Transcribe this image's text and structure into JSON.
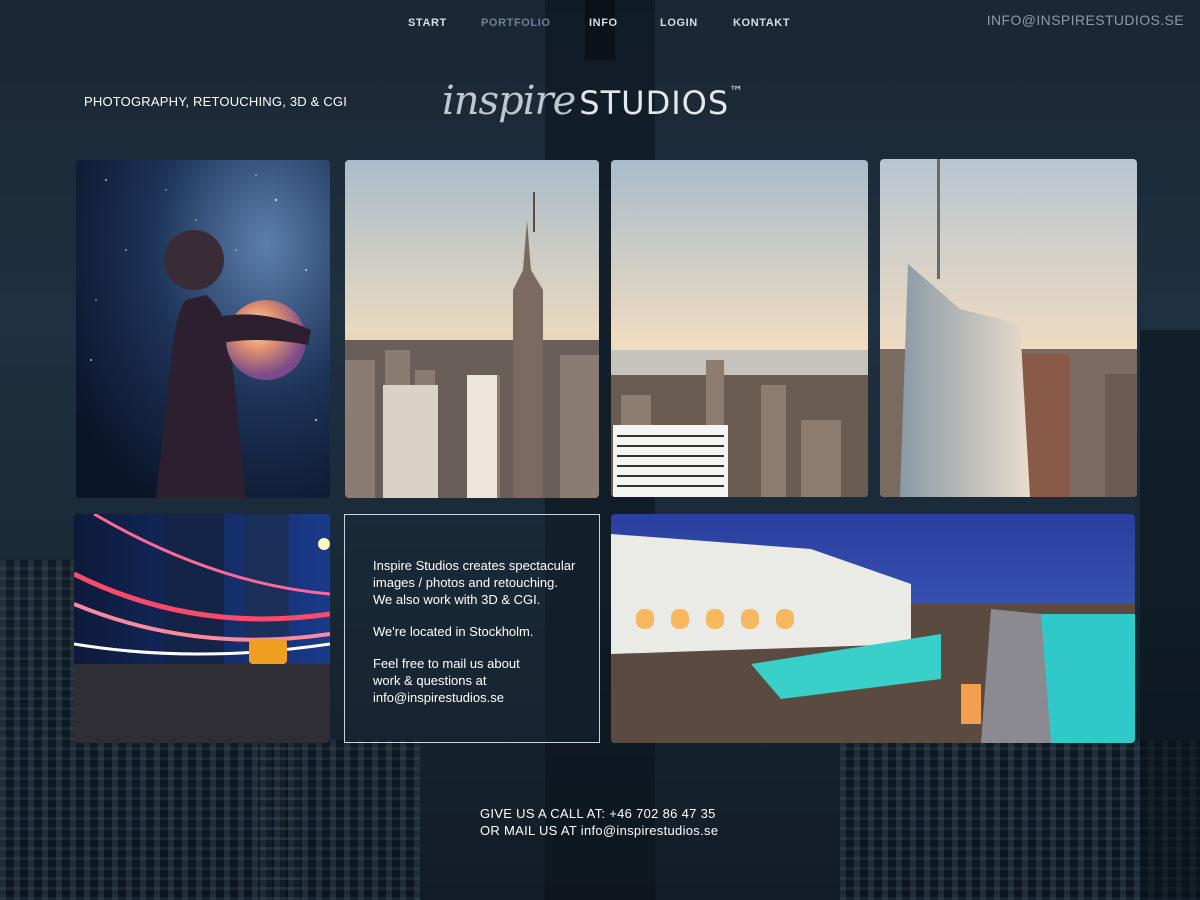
{
  "nav": {
    "items": [
      {
        "label": "START"
      },
      {
        "label": "PORTFOLIO"
      },
      {
        "label": "INFO"
      },
      {
        "label": "LOGIN"
      },
      {
        "label": "KONTAKT"
      }
    ],
    "active": "PORTFOLIO",
    "email": "INFO@INSPIRESTUDIOS.SE"
  },
  "header": {
    "tagline": "PHOTOGRAPHY, RETOUCHING, 3D & CGI",
    "logo_script": "inspire",
    "logo_word": "STUDIOS",
    "logo_tm": "™"
  },
  "gallery": {
    "tiles": [
      {
        "subject": "girl-hugging-glowing-orb"
      },
      {
        "subject": "empire-state-skyline"
      },
      {
        "subject": "manhattan-river-view"
      },
      {
        "subject": "glass-skyscraper-sunset"
      },
      {
        "subject": "city-light-trails-taxi"
      },
      {
        "subject": "hotel-pool-at-dusk"
      }
    ]
  },
  "info": {
    "p1": "Inspire Studios creates spectacular\nimages / photos and retouching.\nWe also work with 3D & CGI.",
    "p2": "We're located in Stockholm.",
    "p3": "Feel free to mail us about\nwork & questions at\ninfo@inspirestudios.se"
  },
  "footer": {
    "line1": "GIVE US A CALL AT: +46 702 86 47 35",
    "line2": "OR MAIL US AT info@inspirestudios.se"
  },
  "colors": {
    "background": "#1f3040",
    "nav_text": "#d6dee6",
    "nav_active": "#6f8193"
  }
}
